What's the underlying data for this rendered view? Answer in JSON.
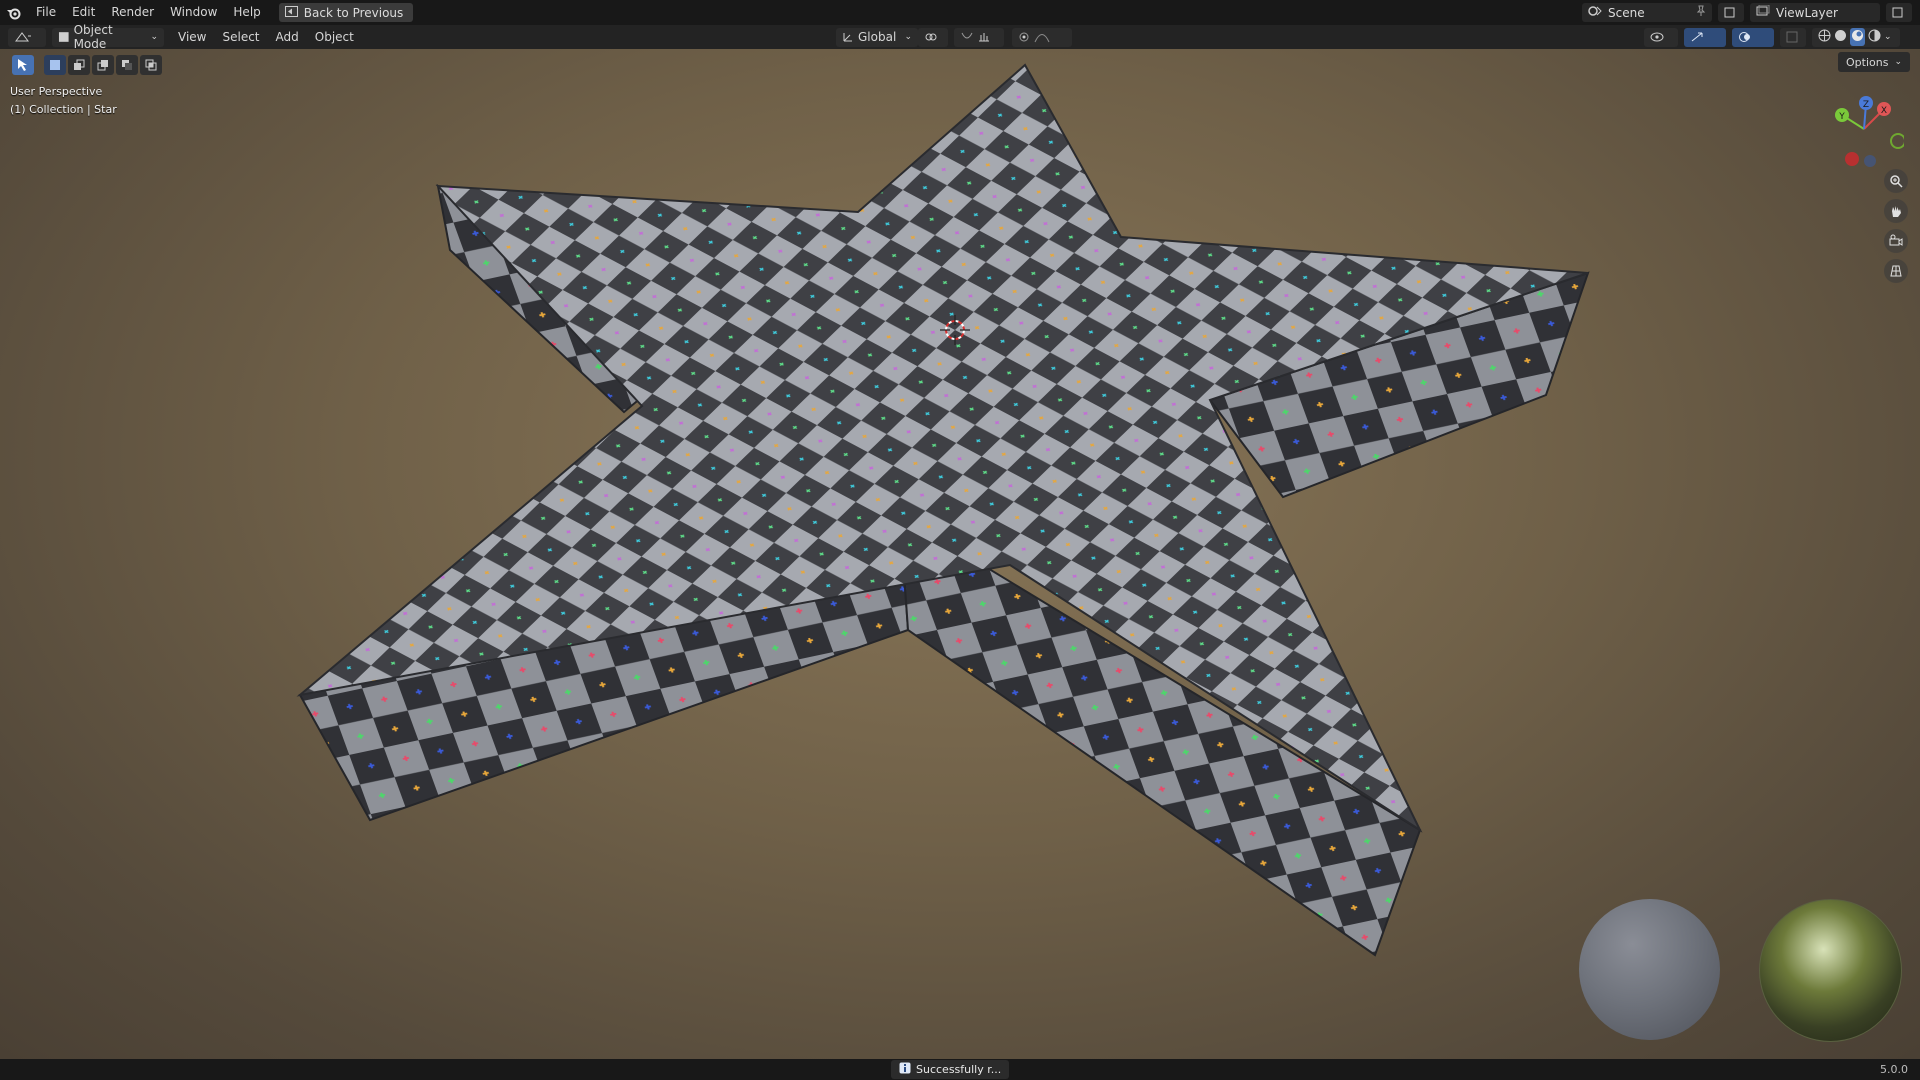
{
  "menu": {
    "items": [
      "File",
      "Edit",
      "Render",
      "Window",
      "Help"
    ],
    "back_label": "Back to Previous"
  },
  "topright": {
    "scene_label": "Scene",
    "viewlayer_label": "ViewLayer"
  },
  "header": {
    "mode_label": "Object Mode",
    "view_menu": [
      "View",
      "Select",
      "Add",
      "Object"
    ],
    "orientation_label": "Global",
    "options_label": "Options"
  },
  "viewport": {
    "perspective_label": "User Perspective",
    "collection_label": "(1) Collection | Star",
    "gizmo_x": "X",
    "gizmo_y": "Y",
    "gizmo_z": "Z"
  },
  "status": {
    "message": "Successfully r...",
    "version": "5.0.0"
  },
  "colors": {
    "accent": "#4772b3",
    "checker_light": "#a6a9b0",
    "checker_dark": "#3f4045"
  },
  "icons": [
    "blender-logo-icon",
    "back-icon",
    "scene-icon",
    "pin-icon",
    "viewlayer-icon",
    "zoom-icon",
    "hand-icon",
    "camera-icon",
    "grid-icon"
  ]
}
